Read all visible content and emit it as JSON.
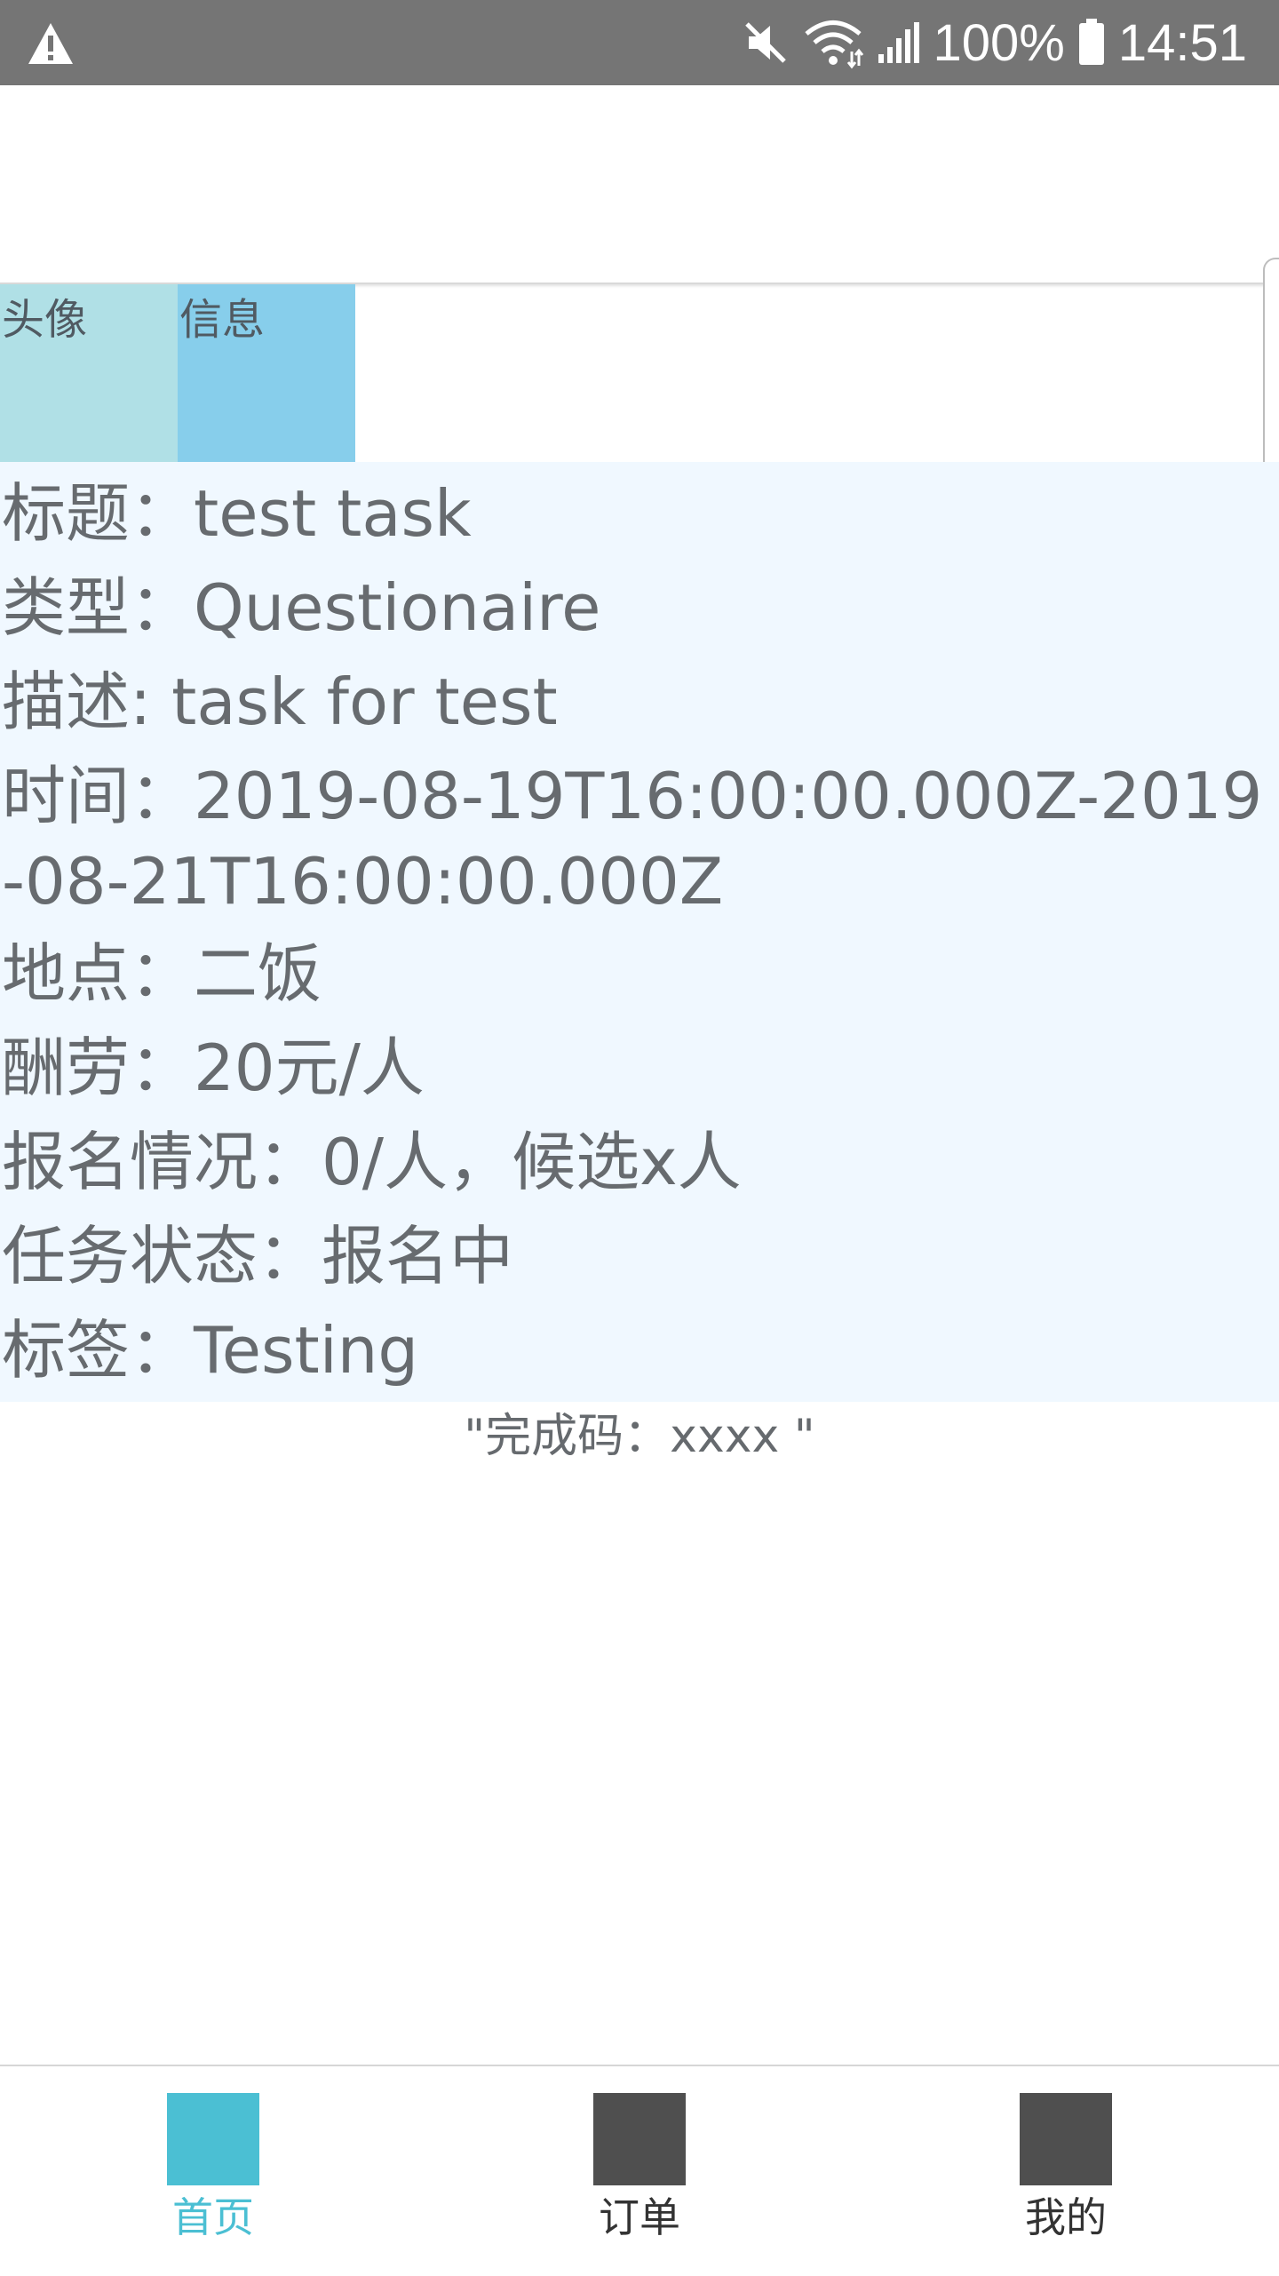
{
  "status_bar": {
    "battery": "100%",
    "time": "14:51",
    "icons": [
      "warning-icon",
      "mute-icon",
      "wifi-icon",
      "signal-icon",
      "battery-icon"
    ]
  },
  "profile": {
    "avatar_label": "头像",
    "info_label": "信息"
  },
  "task": {
    "title": "标题：test task",
    "type": "类型：Questionaire",
    "description": "描述: task for test",
    "time": "时间：2019-08-19T16:00:00.000Z-2019-08-21T16:00:00.000Z",
    "location": "地点：二饭",
    "reward": "酬劳：20元/人",
    "signup": "报名情况：0/人，候选x人",
    "status": "任务状态：报名中",
    "tags": "标签：Testing"
  },
  "completion_code": "\"完成码：xxxx \"",
  "tabbar": {
    "tabs": [
      {
        "label": "首页",
        "active": true,
        "color": "#4bbfd3"
      },
      {
        "label": "订单",
        "active": false,
        "color": "#4f4f4f"
      },
      {
        "label": "我的",
        "active": false,
        "color": "#4f4f4f"
      }
    ]
  }
}
